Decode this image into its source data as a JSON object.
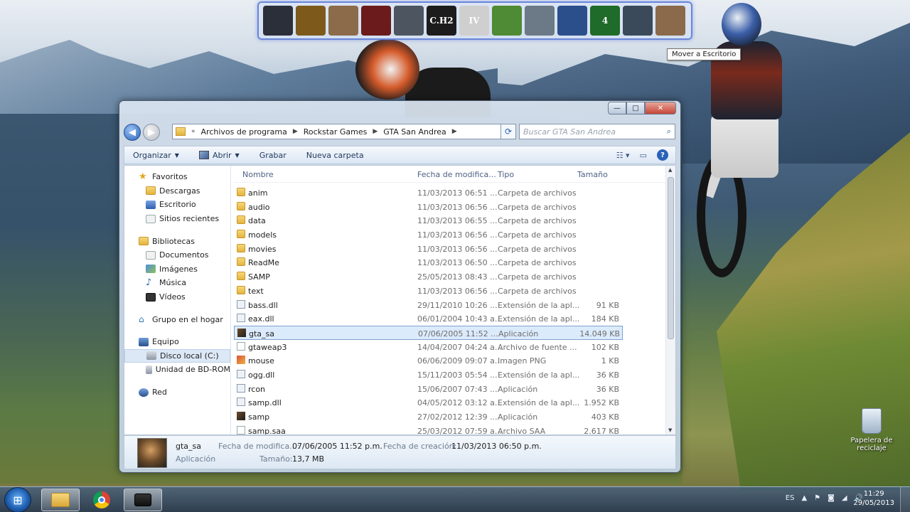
{
  "launcher": {
    "items": [
      {
        "name": "game-1",
        "label": "",
        "color": "#2b2f3a"
      },
      {
        "name": "game-2",
        "label": "",
        "color": "#7d5a1c"
      },
      {
        "name": "game-3",
        "label": "",
        "color": "#8c6b4a"
      },
      {
        "name": "game-4",
        "label": "",
        "color": "#6b1b1b"
      },
      {
        "name": "game-5",
        "label": "",
        "color": "#4c5560"
      },
      {
        "name": "game-6",
        "label": "C.H2",
        "color": "#1c1c1c"
      },
      {
        "name": "game-7",
        "label": "IV",
        "color": "#cfcfcf"
      },
      {
        "name": "game-8",
        "label": "",
        "color": "#4f8a34"
      },
      {
        "name": "game-9",
        "label": "",
        "color": "#6b7a86"
      },
      {
        "name": "game-10",
        "label": "",
        "color": "#2b4f8a"
      },
      {
        "name": "game-11",
        "label": "4",
        "color": "#1f6b2a"
      },
      {
        "name": "game-12",
        "label": "",
        "color": "#3a4a5a"
      },
      {
        "name": "game-13",
        "label": "",
        "color": "#8a6a4a"
      }
    ],
    "tooltip": "Mover a Escritorio"
  },
  "window": {
    "caption": {
      "min": "—",
      "max": "□",
      "close": "✕"
    },
    "nav": {
      "back": "◀",
      "forward": "▶"
    },
    "address": {
      "segments": [
        "Archivos de programa",
        "Rockstar Games",
        "GTA San Andrea"
      ],
      "lead": "«"
    },
    "search_placeholder": "Buscar GTA San Andrea",
    "toolbar": {
      "organize": "Organizar",
      "open": "Abrir",
      "burn": "Grabar",
      "new_folder": "Nueva carpeta"
    },
    "sidebar": [
      {
        "label": "Favoritos",
        "icon": "star-icon",
        "kind": "head"
      },
      {
        "label": "Descargas",
        "icon": "downloads-folder-icon",
        "kind": "sub"
      },
      {
        "label": "Escritorio",
        "icon": "desktop-icon",
        "kind": "sub"
      },
      {
        "label": "Sitios recientes",
        "icon": "recent-places-icon",
        "kind": "sub"
      },
      {
        "label": "Bibliotecas",
        "icon": "libraries-icon",
        "kind": "head-gap"
      },
      {
        "label": "Documentos",
        "icon": "documents-icon",
        "kind": "sub"
      },
      {
        "label": "Imágenes",
        "icon": "pictures-icon",
        "kind": "sub"
      },
      {
        "label": "Música",
        "icon": "music-icon",
        "kind": "sub"
      },
      {
        "label": "Vídeos",
        "icon": "videos-icon",
        "kind": "sub"
      },
      {
        "label": "Grupo en el hogar",
        "icon": "homegroup-icon",
        "kind": "head-gap"
      },
      {
        "label": "Equipo",
        "icon": "computer-icon",
        "kind": "head-gap"
      },
      {
        "label": "Disco local (C:)",
        "icon": "local-disk-icon",
        "kind": "sub-sel"
      },
      {
        "label": "Unidad de BD-ROM",
        "icon": "bd-rom-icon",
        "kind": "sub"
      },
      {
        "label": "Red",
        "icon": "network-icon",
        "kind": "head-gap"
      }
    ],
    "columns": {
      "name": "Nombre",
      "date": "Fecha de modifica...",
      "type": "Tipo",
      "size": "Tamaño"
    },
    "files": [
      {
        "name": "anim",
        "date": "11/03/2013 06:51 ...",
        "type": "Carpeta de archivos",
        "size": "",
        "kind": "folder"
      },
      {
        "name": "audio",
        "date": "11/03/2013 06:56 ...",
        "type": "Carpeta de archivos",
        "size": "",
        "kind": "folder"
      },
      {
        "name": "data",
        "date": "11/03/2013 06:55 ...",
        "type": "Carpeta de archivos",
        "size": "",
        "kind": "folder"
      },
      {
        "name": "models",
        "date": "11/03/2013 06:56 ...",
        "type": "Carpeta de archivos",
        "size": "",
        "kind": "folder"
      },
      {
        "name": "movies",
        "date": "11/03/2013 06:56 ...",
        "type": "Carpeta de archivos",
        "size": "",
        "kind": "folder"
      },
      {
        "name": "ReadMe",
        "date": "11/03/2013 06:50 ...",
        "type": "Carpeta de archivos",
        "size": "",
        "kind": "folder"
      },
      {
        "name": "SAMP",
        "date": "25/05/2013 08:43 ...",
        "type": "Carpeta de archivos",
        "size": "",
        "kind": "folder"
      },
      {
        "name": "text",
        "date": "11/03/2013 06:56 ...",
        "type": "Carpeta de archivos",
        "size": "",
        "kind": "folder"
      },
      {
        "name": "bass.dll",
        "date": "29/11/2010 10:26 ...",
        "type": "Extensión de la apl...",
        "size": "91 KB",
        "kind": "dll"
      },
      {
        "name": "eax.dll",
        "date": "06/01/2004 10:43 a...",
        "type": "Extensión de la apl...",
        "size": "184 KB",
        "kind": "dll"
      },
      {
        "name": "gta_sa",
        "date": "07/06/2005 11:52 ...",
        "type": "Aplicación",
        "size": "14.049 KB",
        "kind": "app",
        "selected": true
      },
      {
        "name": "gtaweap3",
        "date": "14/04/2007 04:24 a...",
        "type": "Archivo de fuente ...",
        "size": "102 KB",
        "kind": "file"
      },
      {
        "name": "mouse",
        "date": "06/06/2009 09:07 a...",
        "type": "Imagen PNG",
        "size": "1 KB",
        "kind": "png"
      },
      {
        "name": "ogg.dll",
        "date": "15/11/2003 05:54 ...",
        "type": "Extensión de la apl...",
        "size": "36 KB",
        "kind": "dll"
      },
      {
        "name": "rcon",
        "date": "15/06/2007 07:43 ...",
        "type": "Aplicación",
        "size": "36 KB",
        "kind": "dll"
      },
      {
        "name": "samp.dll",
        "date": "04/05/2012 03:12 a...",
        "type": "Extensión de la apl...",
        "size": "1.952 KB",
        "kind": "dll"
      },
      {
        "name": "samp",
        "date": "27/02/2012 12:39 ...",
        "type": "Aplicación",
        "size": "403 KB",
        "kind": "app"
      },
      {
        "name": "samp.saa",
        "date": "25/03/2012 07:59 a...",
        "type": "Archivo SAA",
        "size": "2.617 KB",
        "kind": "file"
      }
    ],
    "details": {
      "name": "gta_sa",
      "kind": "Aplicación",
      "modified_label": "Fecha de modifica...:",
      "modified_value": "07/06/2005 11:52 p.m.",
      "created_label": "Fecha de creación:",
      "created_value": "11/03/2013 06:50 p.m.",
      "size_label": "Tamaño:",
      "size_value": "13,7 MB"
    }
  },
  "desktop": {
    "recycle_bin": "Papelera de reciclaje"
  },
  "taskbar": {
    "start": "⊞",
    "clock_time": "11:29",
    "clock_date": "29/05/2013",
    "tray": [
      "ES",
      "▲",
      "⚑",
      "◙",
      "◢",
      "🔊"
    ]
  }
}
